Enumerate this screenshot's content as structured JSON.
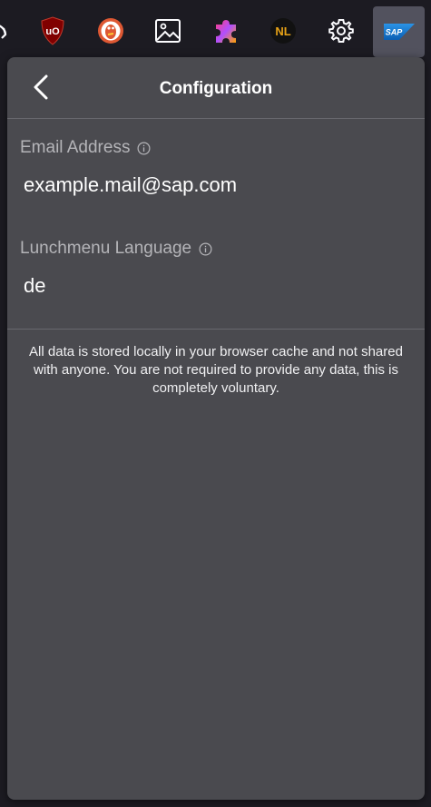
{
  "toolbar": {
    "icons": [
      {
        "name": "partial-edge-icon"
      },
      {
        "name": "ublock-origin-icon",
        "label": "uO"
      },
      {
        "name": "duckduckgo-icon"
      },
      {
        "name": "image-icon"
      },
      {
        "name": "extensions-puzzle-icon"
      },
      {
        "name": "nl-extension-icon",
        "label": "NL"
      },
      {
        "name": "settings-gear-icon"
      },
      {
        "name": "sap-extension-icon",
        "label": "SAP"
      }
    ]
  },
  "panel": {
    "title": "Configuration",
    "fields": [
      {
        "label": "Email Address",
        "value": "example.mail@sap.com"
      },
      {
        "label": "Lunchmenu Language",
        "value": "de"
      }
    ],
    "notice": "All data is stored locally in your browser cache and not shared with anyone. You are not required to provide any data, this is completely voluntary."
  },
  "colors": {
    "panel_bg": "#4a4a4f",
    "toolbar_bg": "#1c1b22",
    "label_gray": "#b4b4b8",
    "text_white": "#ffffff",
    "sap_blue": "#1a73c8",
    "ublock_red": "#800000",
    "ddg_orange": "#de5833"
  }
}
